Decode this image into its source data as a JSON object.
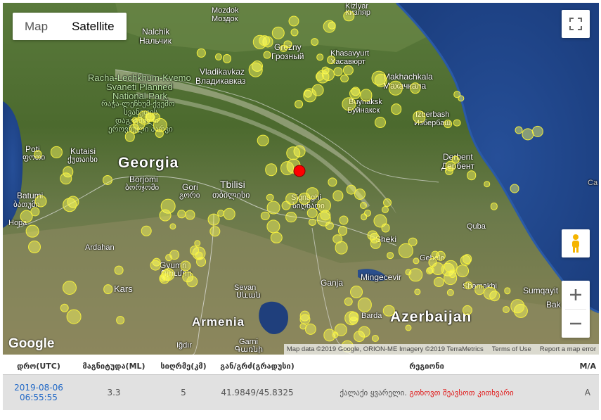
{
  "map": {
    "type_buttons": {
      "map": "Map",
      "satellite": "Satellite"
    },
    "active_type": "Satellite",
    "labels": {
      "mozdok": "Mozdok",
      "mozdok_ru": "Моздок",
      "kizlyar": "Kizlyar",
      "kizlyar_ru": "Кизляр",
      "nalchik": "Nalchik",
      "nalchik_ru": "Нальчик",
      "grozny": "Grozny",
      "grozny_ru": "Грозный",
      "khasavyurt": "Khasavyurt",
      "khasavyurt_ru": "Хасавюрт",
      "vladikavkaz": "Vladikavkaz",
      "vladikavkaz_ru": "Владикавказ",
      "makhachkala": "Makhachkala",
      "makhachkala_ru": "Махачкала",
      "park1": "Racha-Lechkhum-Kvemo",
      "park2": "Svaneti Planned",
      "park3": "National Park",
      "park_ka1": "რაჭა-ლეჩხუმ-ქვემო",
      "park_ka2": "სვანეთის",
      "park_ka3": "დაგეგმილი",
      "park_ka4": "ეროვნული პარკი",
      "buynaksk": "Buynaksk",
      "buynaksk_ru": "Буйнакск",
      "izberbash": "Izberbash",
      "izberbash_ru": "Избербаш",
      "poti": "Poti",
      "poti_ka": "ფოთი",
      "kutaisi": "Kutaisi",
      "kutaisi_ka": "ქუთაისი",
      "georgia": "Georgia",
      "derbent": "Derbent",
      "derbent_ru": "Дербент",
      "borjomi": "Borjomi",
      "borjomi_ka": "ბორჯომი",
      "gori": "Gori",
      "gori_ka": "გორი",
      "tbilisi": "Tbilisi",
      "tbilisi_ka": "თბილისი",
      "batumi": "Batumi",
      "batumi_ka": "ბათუმი",
      "signaghi": "Signaghi",
      "signaghi_ka": "სიღნაღი",
      "hopa": "Hopa",
      "quba": "Quba",
      "sheki": "Sheki",
      "ardahan": "Ardahan",
      "gebele": "Gebele",
      "gyumri": "Gyumri",
      "gyumri_am": "Գյումրի",
      "mingecevir": "Mingecevir",
      "ganja": "Ganja",
      "shamakhi": "Shamakhi",
      "kars": "Kars",
      "sevan": "Sevan",
      "sevan_am": "Սևան",
      "sumqayit": "Sumqayit",
      "baku": "Bak",
      "armenia": "Armenia",
      "barda": "Barda",
      "azerbaijan": "Azerbaijan",
      "igdir": "Iğdır",
      "garni": "Garni",
      "garni_am": "Գառնի",
      "ca": "Ca"
    },
    "attribution": {
      "data": "Map data ©2019 Google, ORION-ME Imagery ©2019 TerraMetrics",
      "terms": "Terms of Use",
      "report": "Report a map error"
    },
    "logo": "Google",
    "epicenter_color": "#ff0000",
    "marker_color": "#f4ef3d"
  },
  "table": {
    "headers": [
      "დრო(UTC)",
      "მაგნიტუდა(ML)",
      "სიღრმე(კმ)",
      "გან/გრძ(გრადუსი)",
      "რეგიონი",
      "M/A"
    ],
    "row": {
      "date": "2019-08-06",
      "time": "06:55:55",
      "magnitude": "3.3",
      "depth": "5",
      "coords": "41.9849/45.8325",
      "region_prefix": "ქალაქი ყვარელი.",
      "region_highlight": "გთხოვთ შეავსოთ კითხვარი",
      "ma": "A"
    }
  }
}
